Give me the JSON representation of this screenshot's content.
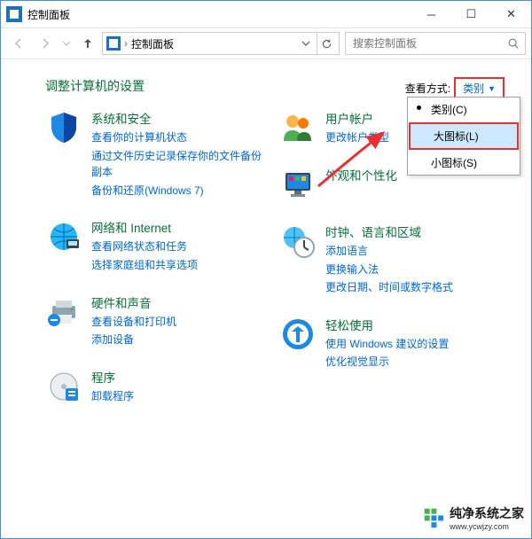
{
  "window": {
    "title": "控制面板"
  },
  "nav": {
    "breadcrumb": "控制面板"
  },
  "search": {
    "placeholder": "搜索控制面板"
  },
  "heading": "调整计算机的设置",
  "viewby": {
    "label": "查看方式:",
    "current": "类别"
  },
  "dropdown": {
    "items": [
      {
        "label": "类别(C)",
        "checked": true,
        "selected": false
      },
      {
        "label": "大图标(L)",
        "checked": false,
        "selected": true
      },
      {
        "label": "小图标(S)",
        "checked": false,
        "selected": false
      }
    ]
  },
  "left": [
    {
      "title": "系统和安全",
      "links": [
        "查看你的计算机状态",
        "通过文件历史记录保存你的文件备份副本",
        "备份和还原(Windows 7)"
      ]
    },
    {
      "title": "网络和 Internet",
      "links": [
        "查看网络状态和任务",
        "选择家庭组和共享选项"
      ]
    },
    {
      "title": "硬件和声音",
      "links": [
        "查看设备和打印机",
        "添加设备"
      ]
    },
    {
      "title": "程序",
      "links": [
        "卸载程序"
      ]
    }
  ],
  "right": [
    {
      "title": "用户帐户",
      "links": [
        "更改帐户类型"
      ]
    },
    {
      "title": "外观和个性化",
      "links": []
    },
    {
      "title": "时钟、语言和区域",
      "links": [
        "添加语言",
        "更换输入法",
        "更改日期、时间或数字格式"
      ]
    },
    {
      "title": "轻松使用",
      "links": [
        "使用 Windows 建议的设置",
        "优化视觉显示"
      ]
    }
  ],
  "watermark": {
    "brand": "纯净系统之家",
    "url": "www.ycwjzy.com"
  }
}
